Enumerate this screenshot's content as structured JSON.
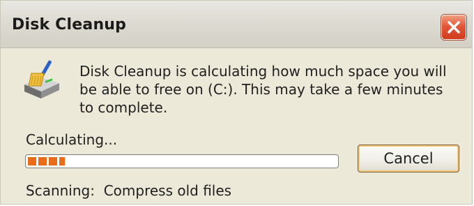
{
  "window": {
    "title": "Disk Cleanup"
  },
  "title_bar": {
    "close_icon": "close-x-icon"
  },
  "dialog": {
    "app_icon": "disk-cleanup-broom-icon",
    "message": "Disk Cleanup is calculating how much space you will be able to free on  (C:). This may take a few minutes to complete.",
    "progress_label": "Calculating...",
    "progress_fraction": 0.12,
    "cancel_label": "Cancel",
    "status_prefix": "Scanning:",
    "status_value": "Compress old files"
  },
  "colors": {
    "titlebar": "#dedcd3",
    "close_button": "#e3583a",
    "window_body": "#ece9d8",
    "progress_fill": "#e86c1a",
    "button_focus": "#f3c97a"
  }
}
